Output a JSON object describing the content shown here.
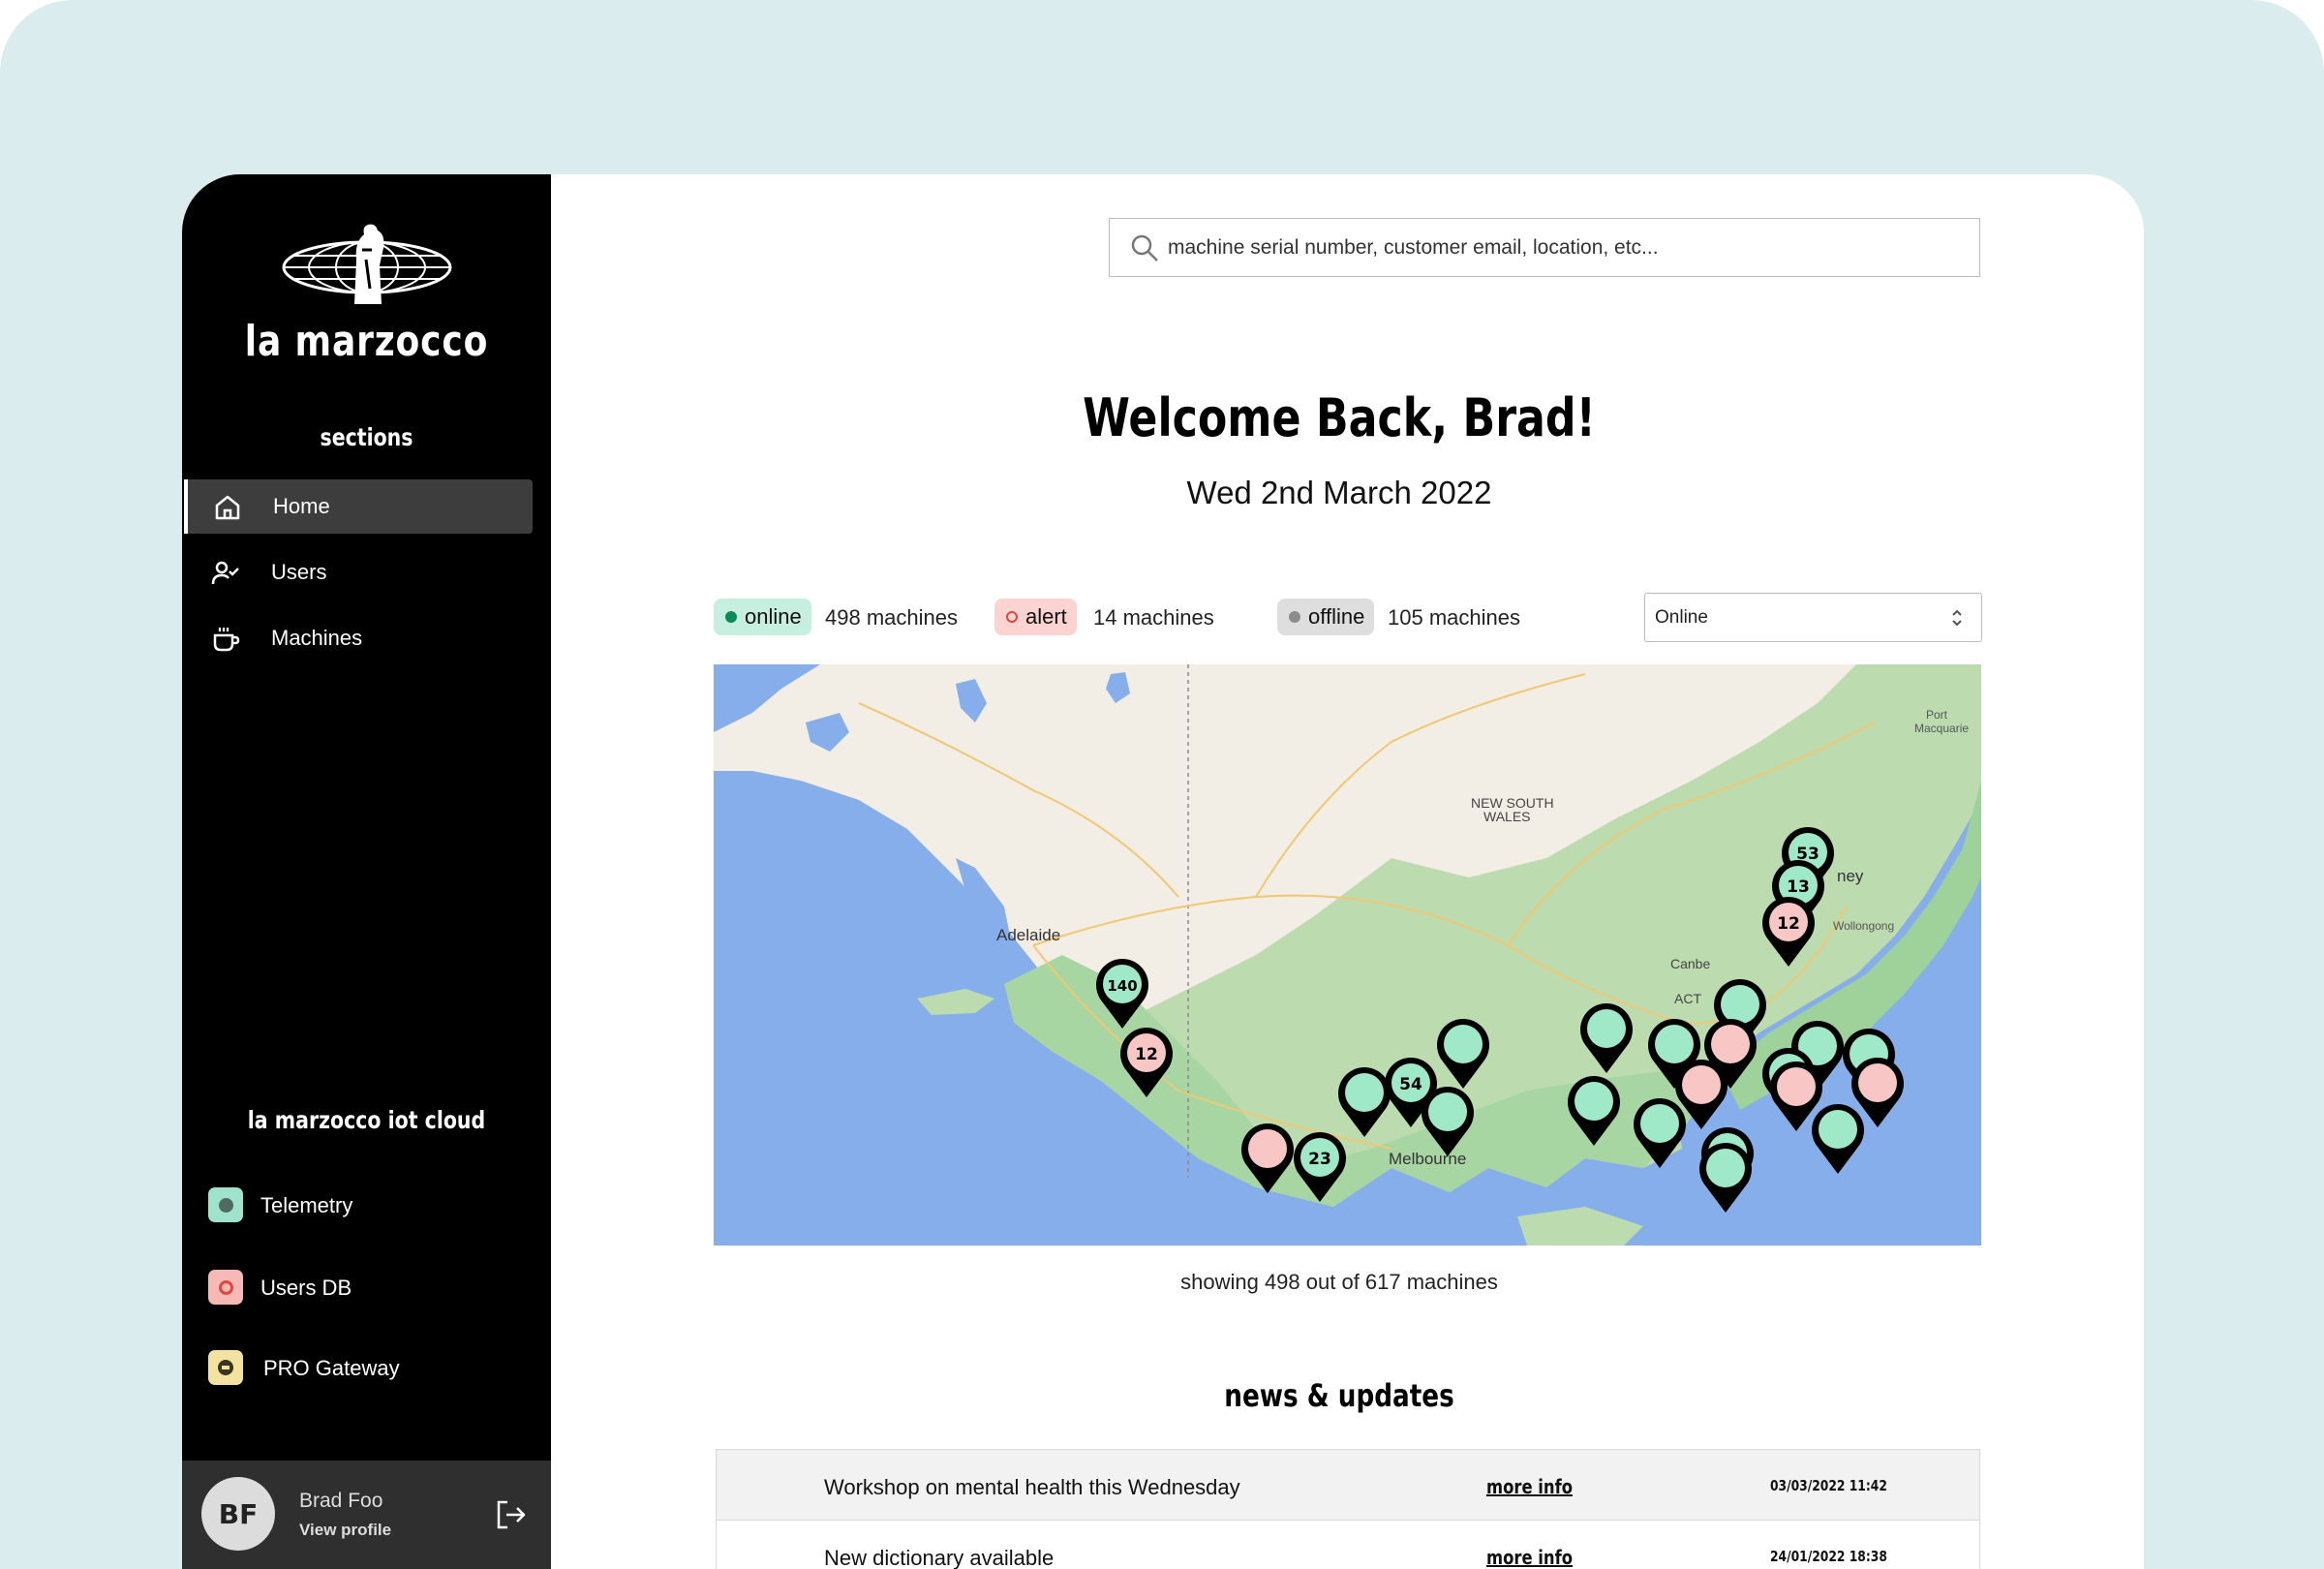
{
  "brand": {
    "name": "la marzocco"
  },
  "sidebar": {
    "section_title": "sections",
    "items": [
      {
        "label": "Home",
        "icon": "home-icon",
        "active": true
      },
      {
        "label": "Users",
        "icon": "user-check-icon",
        "active": false
      },
      {
        "label": "Machines",
        "icon": "coffee-cup-icon",
        "active": false
      }
    ],
    "cloud_title": "la marzocco iot cloud",
    "cloud_items": [
      {
        "label": "Telemetry",
        "color": "#9fe3cc",
        "dot": "#4f6b62"
      },
      {
        "label": "Users DB",
        "color": "#f6b9b5",
        "dot": "#e0473c"
      },
      {
        "label": "PRO Gateway",
        "color": "#f2e3a0",
        "dot": "#5c5535"
      }
    ]
  },
  "profile": {
    "initials": "BF",
    "name": "Brad Foo",
    "link": "View profile"
  },
  "search": {
    "placeholder": "machine serial number, customer email, location, etc..."
  },
  "welcome": {
    "title": "Welcome Back, Brad!",
    "date": "Wed 2nd March 2022"
  },
  "status": {
    "online": {
      "label": "online",
      "count": "498 machines",
      "bg": "#c6efe0",
      "dot": "#0a8a55"
    },
    "alert": {
      "label": "alert",
      "count": "14 machines",
      "bg": "#fbd3d0",
      "dot": "#e0473c"
    },
    "offline": {
      "label": "offline",
      "count": "105 machines",
      "bg": "#dedede",
      "dot": "#8c8c8c"
    }
  },
  "filter": {
    "selected": "Online"
  },
  "map": {
    "labels": [
      "Adelaide",
      "NEW SOUTH",
      "WALES",
      "Melbourne",
      "Canbe",
      "ACT",
      "ney",
      "Wollongong",
      "Port",
      "Macquarie"
    ],
    "pins": [
      {
        "label": "53",
        "status": "online"
      },
      {
        "label": "13",
        "status": "online"
      },
      {
        "label": "12",
        "status": "alert"
      },
      {
        "label": "140",
        "status": "online"
      },
      {
        "label": "12",
        "status": "alert"
      },
      {
        "label": "54",
        "status": "online"
      },
      {
        "label": "23",
        "status": "online"
      }
    ],
    "colors": {
      "online": "#9fe8c8",
      "alert": "#f8c6c4"
    }
  },
  "map_caption": "showing 498 out of 617 machines",
  "news": {
    "title": "news & updates",
    "rows": [
      {
        "text": "Workshop on mental health this Wednesday",
        "link": "more info",
        "date": "03/03/2022 11:42"
      },
      {
        "text": "New dictionary available",
        "link": "more info",
        "date": "24/01/2022 18:38"
      }
    ]
  }
}
